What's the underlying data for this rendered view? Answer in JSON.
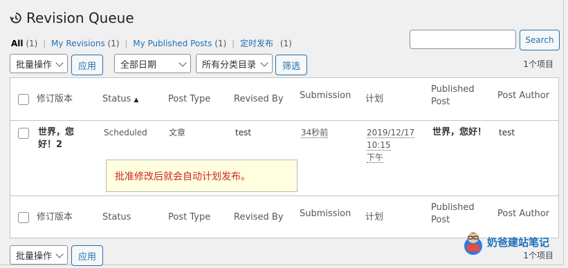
{
  "header": {
    "title": "Revision Queue"
  },
  "filters": {
    "all_label": "All",
    "all_count": "(1)",
    "my_revisions_label": "My Revisions",
    "my_revisions_count": "(1)",
    "my_published_label": "My Published Posts",
    "my_published_count": "(1)",
    "scheduled_label": "定时发布",
    "scheduled_count": "(1)",
    "separator": "|"
  },
  "search": {
    "button_label": "Search",
    "value": ""
  },
  "toolbar": {
    "bulk_action": "批量操作",
    "apply": "应用",
    "date_filter": "全部日期",
    "category_filter": "所有分类目录",
    "filter_button": "筛选",
    "items_count": "1个项目"
  },
  "table": {
    "columns": [
      "修订版本",
      "Status",
      "Post Type",
      "Revised By",
      "Submission",
      "计划",
      "Published Post",
      "Post Author"
    ],
    "sort_indicator": "▲",
    "row": {
      "revision_title": "世界，您好！2",
      "status": "Scheduled",
      "post_type": "文章",
      "revised_by": "test",
      "submission": "34秒前",
      "schedule_date": "2019/12/17",
      "schedule_time": "10:15",
      "schedule_ampm": "下午",
      "published_post": "世界，您好！",
      "post_author": "test"
    }
  },
  "note": "批准修改后就会自动计划发布。",
  "bottom_toolbar": {
    "bulk_action": "批量操作",
    "apply": "应用",
    "items_count": "1个项目"
  },
  "watermark": {
    "text": "奶爸建站笔记"
  },
  "colors": {
    "link": "#2271b1",
    "note_text": "#d1251e",
    "note_bg": "#ffffe0"
  }
}
